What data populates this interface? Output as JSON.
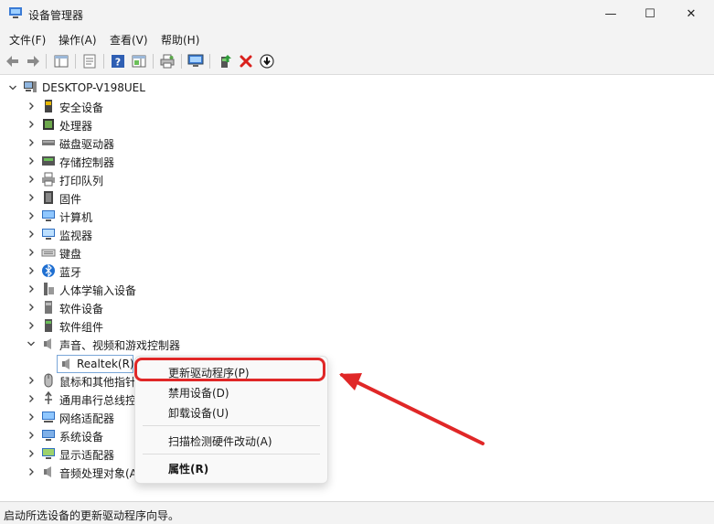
{
  "window": {
    "title": "设备管理器",
    "minimize": "—",
    "maximize": "☐",
    "close": "✕"
  },
  "menu": [
    "文件(F)",
    "操作(A)",
    "查看(V)",
    "帮助(H)"
  ],
  "tree": {
    "root": "DESKTOP-V198UEL",
    "categories": [
      "安全设备",
      "处理器",
      "磁盘驱动器",
      "存储控制器",
      "打印队列",
      "固件",
      "计算机",
      "监视器",
      "键盘",
      "蓝牙",
      "人体学输入设备",
      "软件设备",
      "软件组件",
      "声音、视频和游戏控制器"
    ],
    "child": "Realtek(R)",
    "after": [
      "鼠标和其他指针",
      "通用串行总线控",
      "网络适配器",
      "系统设备",
      "显示适配器",
      "音频处理对象(A"
    ]
  },
  "context_menu": {
    "update_driver": "更新驱动程序(P)",
    "disable": "禁用设备(D)",
    "uninstall": "卸载设备(U)",
    "scan": "扫描检测硬件改动(A)",
    "properties": "属性(R)"
  },
  "status": "启动所选设备的更新驱动程序向导。",
  "colors": {
    "highlight": "#e02727",
    "accent": "#1f6fd1"
  }
}
